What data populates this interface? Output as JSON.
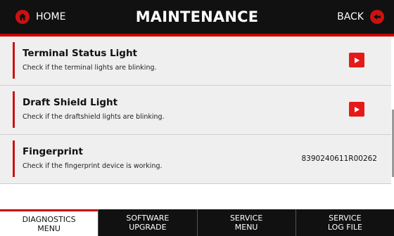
{
  "header": {
    "home_label": "HOME",
    "title": "MAINTENANCE",
    "back_label": "BACK"
  },
  "colors": {
    "accent": "#cc0000",
    "header_bg": "#111111",
    "row_bg": "#efefef",
    "play_button": "#e61919"
  },
  "items": [
    {
      "title": "Terminal Status Light",
      "description": "Check if the terminal lights are blinking.",
      "action_icon": "play-icon"
    },
    {
      "title": "Draft Shield Light",
      "description": "Check if the draftshield lights are blinking.",
      "action_icon": "play-icon"
    },
    {
      "title": "Fingerprint",
      "description": "Check if the fingerprint device is working.",
      "value": "8390240611R00262"
    }
  ],
  "tabs": [
    {
      "label": "DIAGNOSTICS\nMENU",
      "active": true
    },
    {
      "label": "SOFTWARE\nUPGRADE",
      "active": false
    },
    {
      "label": "SERVICE\nMENU",
      "active": false
    },
    {
      "label": "SERVICE\nLOG FILE",
      "active": false
    }
  ]
}
